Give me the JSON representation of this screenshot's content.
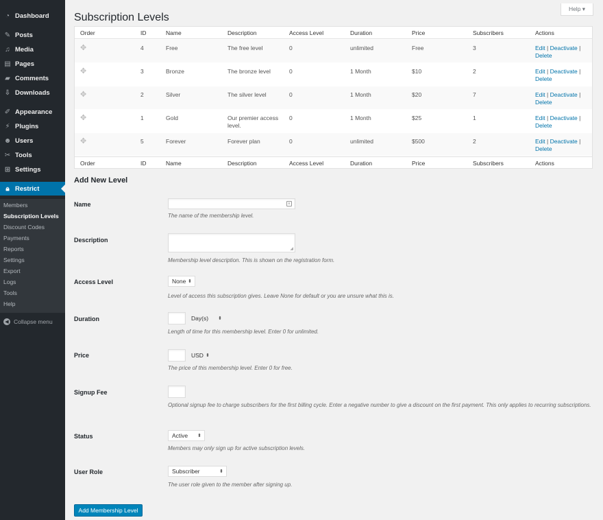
{
  "sidebar": {
    "menu": [
      {
        "key": "dashboard",
        "label": "Dashboard",
        "icon": "dashboard-icon"
      },
      {
        "key": "posts",
        "label": "Posts",
        "icon": "pin-icon"
      },
      {
        "key": "media",
        "label": "Media",
        "icon": "media-icon"
      },
      {
        "key": "pages",
        "label": "Pages",
        "icon": "page-icon"
      },
      {
        "key": "comments",
        "label": "Comments",
        "icon": "comment-icon"
      },
      {
        "key": "downloads",
        "label": "Downloads",
        "icon": "download-icon"
      },
      {
        "key": "appearance",
        "label": "Appearance",
        "icon": "brush-icon"
      },
      {
        "key": "plugins",
        "label": "Plugins",
        "icon": "plug-icon"
      },
      {
        "key": "users",
        "label": "Users",
        "icon": "user-icon"
      },
      {
        "key": "tools",
        "label": "Tools",
        "icon": "wrench-icon"
      },
      {
        "key": "settings",
        "label": "Settings",
        "icon": "settings-icon"
      },
      {
        "key": "restrict",
        "label": "Restrict",
        "icon": "lock-icon"
      }
    ],
    "submenu": [
      "Members",
      "Subscription Levels",
      "Discount Codes",
      "Payments",
      "Reports",
      "Settings",
      "Export",
      "Logs",
      "Tools",
      "Help"
    ],
    "collapse_label": "Collapse menu"
  },
  "header": {
    "title": "Subscription Levels",
    "help_label": "Help ▾"
  },
  "table": {
    "columns": [
      "Order",
      "ID",
      "Name",
      "Description",
      "Access Level",
      "Duration",
      "Price",
      "Subscribers",
      "Actions"
    ],
    "rows": [
      {
        "id": "4",
        "name": "Free",
        "description": "The free level",
        "access": "0",
        "duration": "unlimited",
        "price": "Free",
        "subscribers": "3"
      },
      {
        "id": "3",
        "name": "Bronze",
        "description": "The bronze level",
        "access": "0",
        "duration": "1 Month",
        "price": "$10",
        "subscribers": "2"
      },
      {
        "id": "2",
        "name": "Silver",
        "description": "The silver level",
        "access": "0",
        "duration": "1 Month",
        "price": "$20",
        "subscribers": "7"
      },
      {
        "id": "1",
        "name": "Gold",
        "description": "Our premier access level.",
        "access": "0",
        "duration": "1 Month",
        "price": "$25",
        "subscribers": "1"
      },
      {
        "id": "5",
        "name": "Forever",
        "description": "Forever plan",
        "access": "0",
        "duration": "unlimited",
        "price": "$500",
        "subscribers": "2"
      }
    ],
    "actions": {
      "edit": "Edit",
      "deactivate": "Deactivate",
      "delete": "Delete",
      "sep": "|"
    }
  },
  "form": {
    "title": "Add New Level",
    "name": {
      "label": "Name",
      "desc": "The name of the membership level."
    },
    "description": {
      "label": "Description",
      "desc": "Membership level description. This is shown on the registration form."
    },
    "access": {
      "label": "Access Level",
      "value": "None",
      "desc": "Level of access this subscription gives. Leave None for default or you are unsure what this is."
    },
    "duration": {
      "label": "Duration",
      "unit": "Day(s)",
      "desc": "Length of time for this membership level. Enter 0 for unlimited."
    },
    "price": {
      "label": "Price",
      "currency": "USD",
      "desc": "The price of this membership level. Enter 0 for free."
    },
    "signup_fee": {
      "label": "Signup Fee",
      "desc": "Optional signup fee to charge subscribers for the first billing cycle. Enter a negative number to give a discount on the first payment. This only applies to recurring subscriptions."
    },
    "status": {
      "label": "Status",
      "value": "Active",
      "desc": "Members may only sign up for active subscription levels."
    },
    "role": {
      "label": "User Role",
      "value": "Subscriber",
      "desc": "The user role given to the member after signing up."
    },
    "submit_label": "Add Membership Level"
  }
}
